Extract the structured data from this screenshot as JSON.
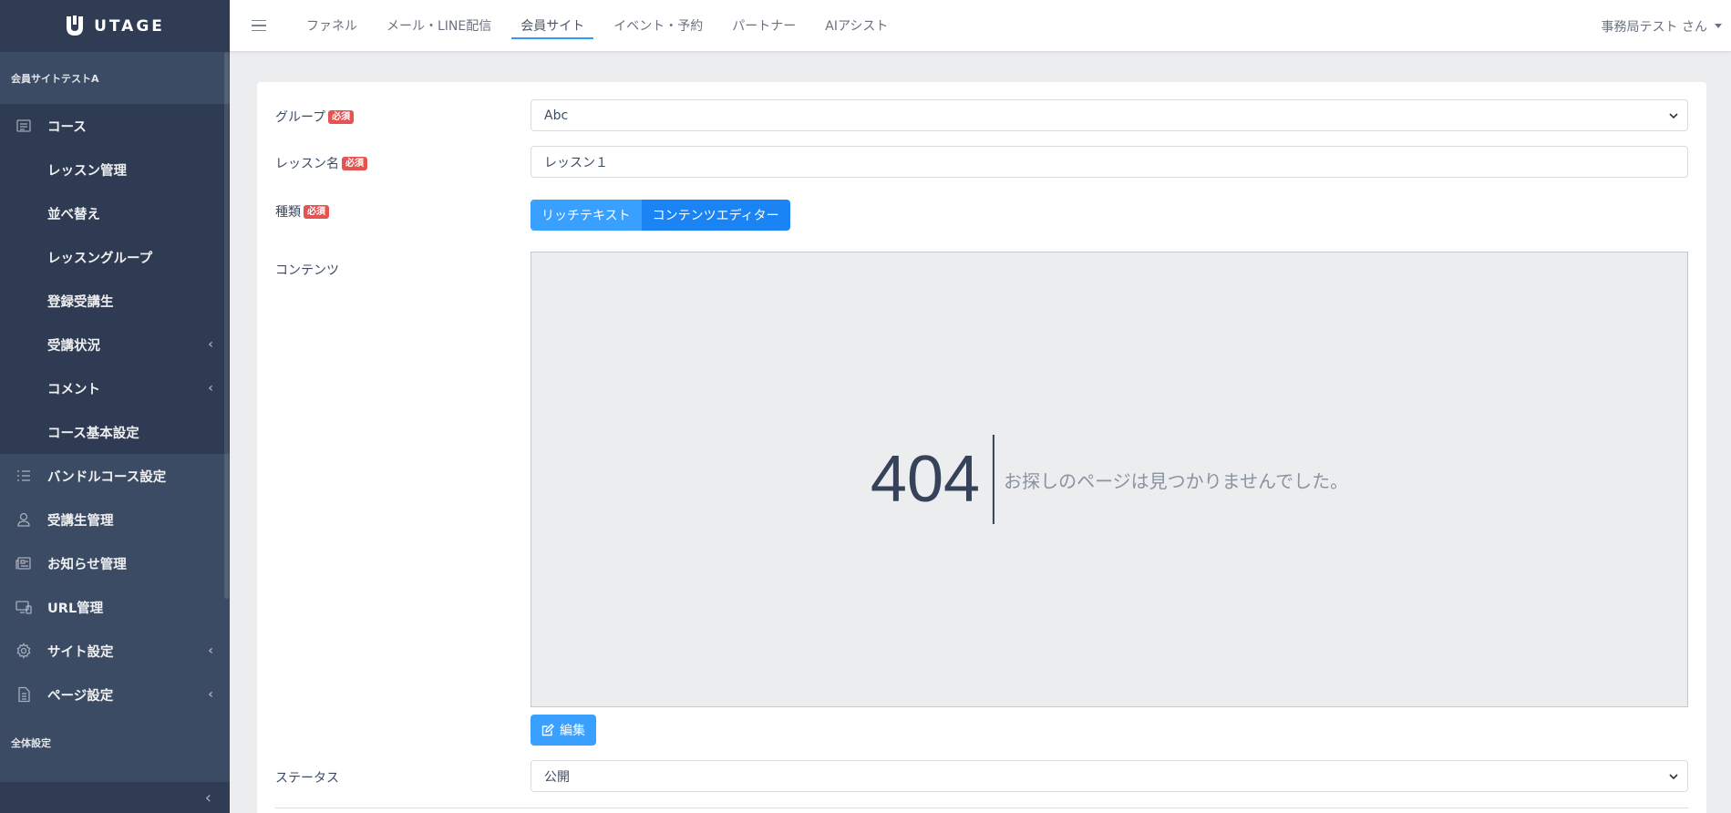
{
  "brand": {
    "name": "UTAGE"
  },
  "sidebar": {
    "section_site": "会員サイトテストA",
    "course": {
      "label": "コース"
    },
    "course_children": [
      {
        "label": "レッスン管理"
      },
      {
        "label": "並べ替え"
      },
      {
        "label": "レッスングループ"
      },
      {
        "label": "登録受講生"
      },
      {
        "label": "受講状況",
        "caret": "‹"
      },
      {
        "label": "コメント",
        "caret": "‹"
      },
      {
        "label": "コース基本設定"
      }
    ],
    "items": [
      {
        "label": "バンドルコース設定",
        "icon": "list-icon"
      },
      {
        "label": "受講生管理",
        "icon": "user-icon"
      },
      {
        "label": "お知らせ管理",
        "icon": "newspaper-icon"
      },
      {
        "label": "URL管理",
        "icon": "monitor-icon"
      },
      {
        "label": "サイト設定",
        "icon": "gear-icon",
        "caret": "‹"
      },
      {
        "label": "ページ設定",
        "icon": "file-icon",
        "caret": "‹"
      }
    ],
    "section_global": "全体設定",
    "toggler": "‹"
  },
  "header": {
    "tabs": [
      {
        "label": "ファネル"
      },
      {
        "label": "メール・LINE配信"
      },
      {
        "label": "会員サイト",
        "active": true
      },
      {
        "label": "イベント・予約"
      },
      {
        "label": "パートナー"
      },
      {
        "label": "AIアシスト"
      }
    ],
    "user": "事務局テスト さん"
  },
  "form": {
    "required_badge": "必須",
    "group": {
      "label": "グループ",
      "value": "Abc"
    },
    "lesson_name": {
      "label": "レッスン名",
      "value": "レッスン１"
    },
    "type": {
      "label": "種類",
      "option1": "リッチテキスト",
      "option2": "コンテンツエディター"
    },
    "content": {
      "label": "コンテンツ",
      "error_code": "404",
      "error_message": "お探しのページは見つかりませんでした。",
      "edit_button": "編集"
    },
    "status": {
      "label": "ステータス",
      "value": "公開"
    }
  },
  "colors": {
    "sidebar_bg": "#3c4b64",
    "accent": "#3399ff",
    "required": "#e55353"
  }
}
